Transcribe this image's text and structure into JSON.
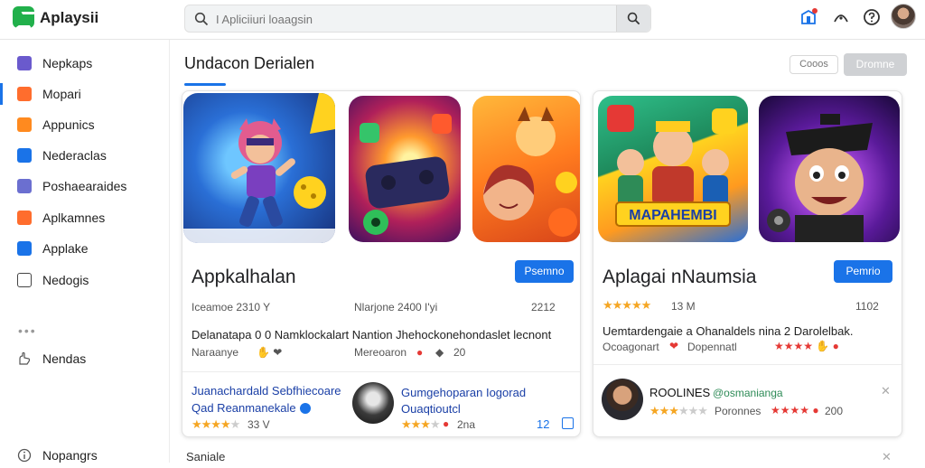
{
  "app": {
    "brand": "Aplaysii"
  },
  "search": {
    "placeholder": "I Apliciiuri loaagsin"
  },
  "sidebar": {
    "items": [
      {
        "label": "Nepkaps",
        "icon": "apps-icon",
        "color": "#6a5acd"
      },
      {
        "label": "Mopari",
        "icon": "play-icon",
        "color": "#ff6d2d"
      },
      {
        "label": "Appunics",
        "icon": "grid-icon",
        "color": "#ff8a1f"
      },
      {
        "label": "Nederaclas",
        "icon": "edit-icon",
        "color": "#1a73e8"
      },
      {
        "label": "Poshaearaides",
        "icon": "folder-icon",
        "color": "#6b6fd0"
      },
      {
        "label": "Aplkamnes",
        "icon": "gamepad-icon",
        "color": "#ff6d2d"
      },
      {
        "label": "Applake",
        "icon": "store-icon",
        "color": "#1a73e8"
      },
      {
        "label": "Nedogis",
        "icon": "square-icon",
        "color": "#444444"
      },
      {
        "label": "Nendas",
        "icon": "hand-icon",
        "color": "#555555"
      },
      {
        "label": "Nopangrs",
        "icon": "info-icon",
        "color": "#555555"
      }
    ],
    "dots": "•••"
  },
  "main": {
    "section_title": "Undacon Derialen",
    "btn_ghost": "Cooos",
    "btn_primary": "Dromne",
    "bottom_label": "Saniale"
  },
  "card1": {
    "title": "Appkalhalan",
    "install": "Psemno",
    "meta": [
      "Iceamoe 2310 Y",
      "Nlarjone 2400 I'yi",
      "2212"
    ],
    "desc": "Delanatapa 0 0 Namklockalart  Nantion Jhehockonehondaslet lecnont",
    "sub1": "Naraanye",
    "sub2": "Mereoaron",
    "sub2_num": "20",
    "promo1_line1": "Juanachardald Sebfhiecoare",
    "promo1_line2": "Qad Reanmanekale",
    "promo1_stars": "★★★★",
    "promo1_stars_off": "★",
    "promo1_meta": "33 V",
    "promo2_line1": "Gumgehoparan Iogorad",
    "promo2_line2": "Ouaqtioutcl",
    "promo2_stars": "★★★",
    "promo2_stars_off": "★",
    "promo2_meta": "2na",
    "promo2_badge": "12"
  },
  "card2": {
    "title": "Aplagai nNaumsia",
    "install": "Pemrio",
    "stars": "★★★★★",
    "meta": "13 M",
    "meta_right": "1102",
    "desc": "Uemtardengaie a Ohanaldels nina 2 Darolelbak.",
    "sub1": "Ocoagonart",
    "sub2": "Dopennatl",
    "promo_title": "ROOLINES",
    "promo_handle": "@osmanianga",
    "promo_stars": "★★★",
    "promo_stars_off": "★★★",
    "promo_meta": "Poronnes",
    "promo_num": "200"
  },
  "colors": {
    "accent": "#1a73e8",
    "brand": "#21b04b",
    "star": "#f5a623"
  }
}
